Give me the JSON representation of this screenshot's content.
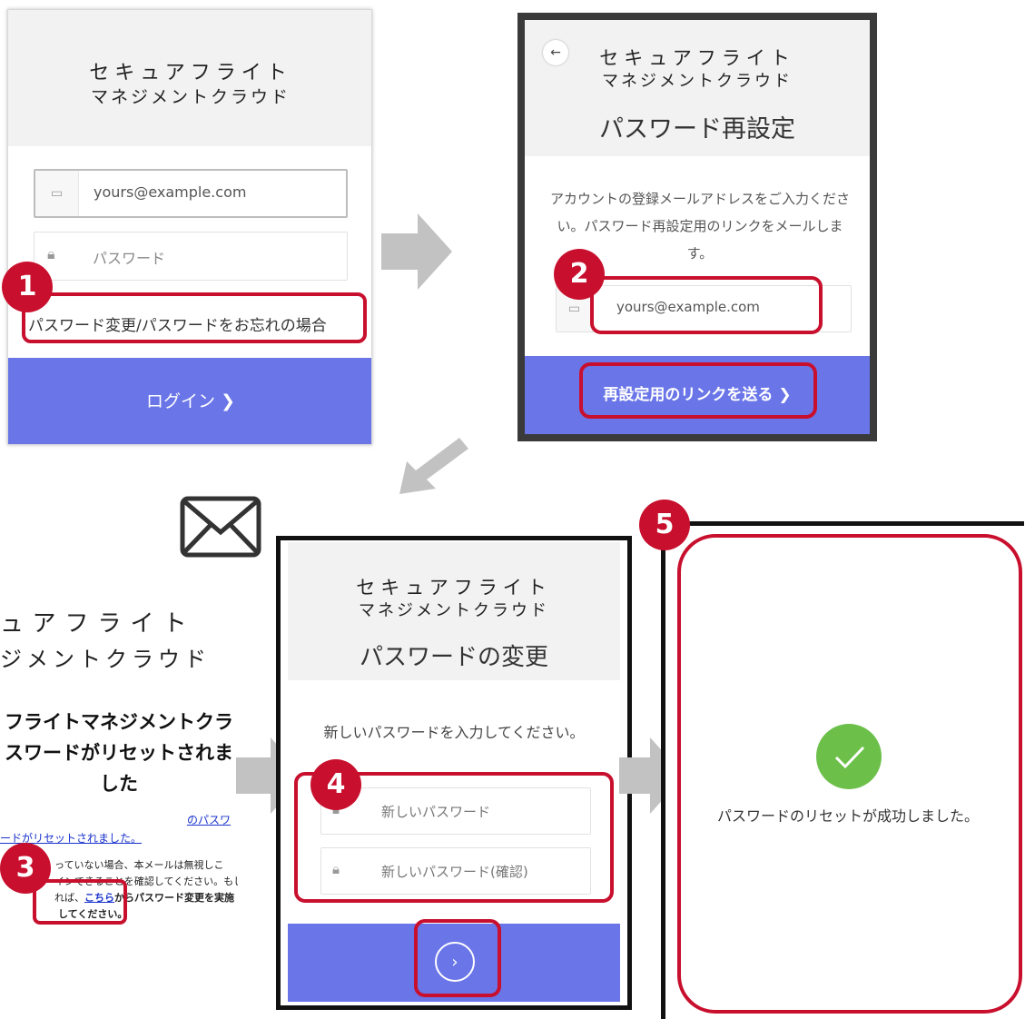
{
  "brand": {
    "line1": "セキュアフライト",
    "line2": "マネジメントクラウド"
  },
  "step1": {
    "email_value": "yours@example.com",
    "password_placeholder": "パスワード",
    "forgot_link": "パスワード変更/パスワードをお忘れの場合",
    "login_button": "ログイン",
    "badge": "1"
  },
  "step2": {
    "title": "パスワード再設定",
    "description": "アカウントの登録メールアドレスをご入力ください。パスワード再設定用のリンクをメールします。",
    "email_value": "yours@example.com",
    "send_button": "再設定用のリンクを送る",
    "badge": "2"
  },
  "step3": {
    "brand_line1": "ュアフライト",
    "brand_line2": "ジメントクラウド",
    "heading": "フライトマネジメントクラスワードがリセットされました",
    "link_fragment": "のパスワ",
    "link_line": "ードがリセットされました。",
    "body_line1": "っていない場合、本メールは無視しこ",
    "body_line2": "インできることを確認してください。もし",
    "body_line3_pre": "れば、",
    "body_link": "こちら",
    "body_line3_post": "からパスワード変更を実施",
    "body_line4": "してください。",
    "badge": "3"
  },
  "step4": {
    "title": "パスワードの変更",
    "instruction": "新しいパスワードを入力してください。",
    "new_password_placeholder": "新しいパスワード",
    "confirm_password_placeholder": "新しいパスワード(確認)",
    "badge": "4"
  },
  "step5": {
    "success_message": "パスワードのリセットが成功しました。",
    "badge": "5"
  },
  "colors": {
    "accent": "#6a75e8",
    "highlight": "#c8102e",
    "success": "#6cc04a"
  }
}
